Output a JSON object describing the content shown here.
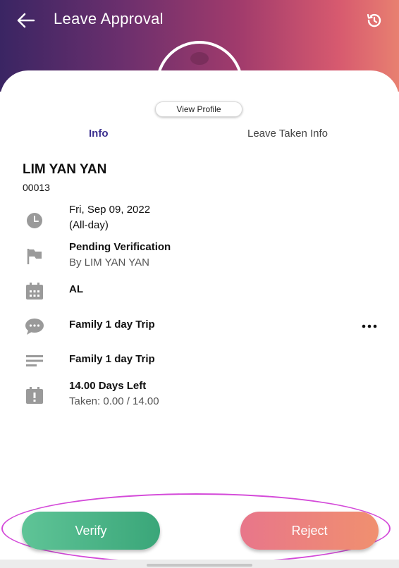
{
  "header": {
    "title": "Leave Approval"
  },
  "profile": {
    "view_profile_label": "View Profile"
  },
  "tabs": [
    {
      "label": "Info",
      "active": true
    },
    {
      "label": "Leave Taken Info",
      "active": false
    }
  ],
  "employee": {
    "name": "LIM YAN YAN",
    "id": "00013"
  },
  "details": {
    "date": {
      "line1": "Fri, Sep 09, 2022",
      "line2": "(All-day)"
    },
    "status": {
      "line1": "Pending Verification",
      "line2": "By LIM YAN YAN"
    },
    "leave_type": "AL",
    "comment": "Family 1 day Trip",
    "reason": "Family 1 day Trip",
    "balance": {
      "line1": "14.00 Days Left",
      "line2": "Taken: 0.00 / 14.00"
    }
  },
  "actions": {
    "verify_label": "Verify",
    "reject_label": "Reject"
  },
  "colors": {
    "accent": "#3b2f8f",
    "verify": "#4fb888",
    "reject": "#ec8279",
    "highlight": "#d44ad9"
  }
}
